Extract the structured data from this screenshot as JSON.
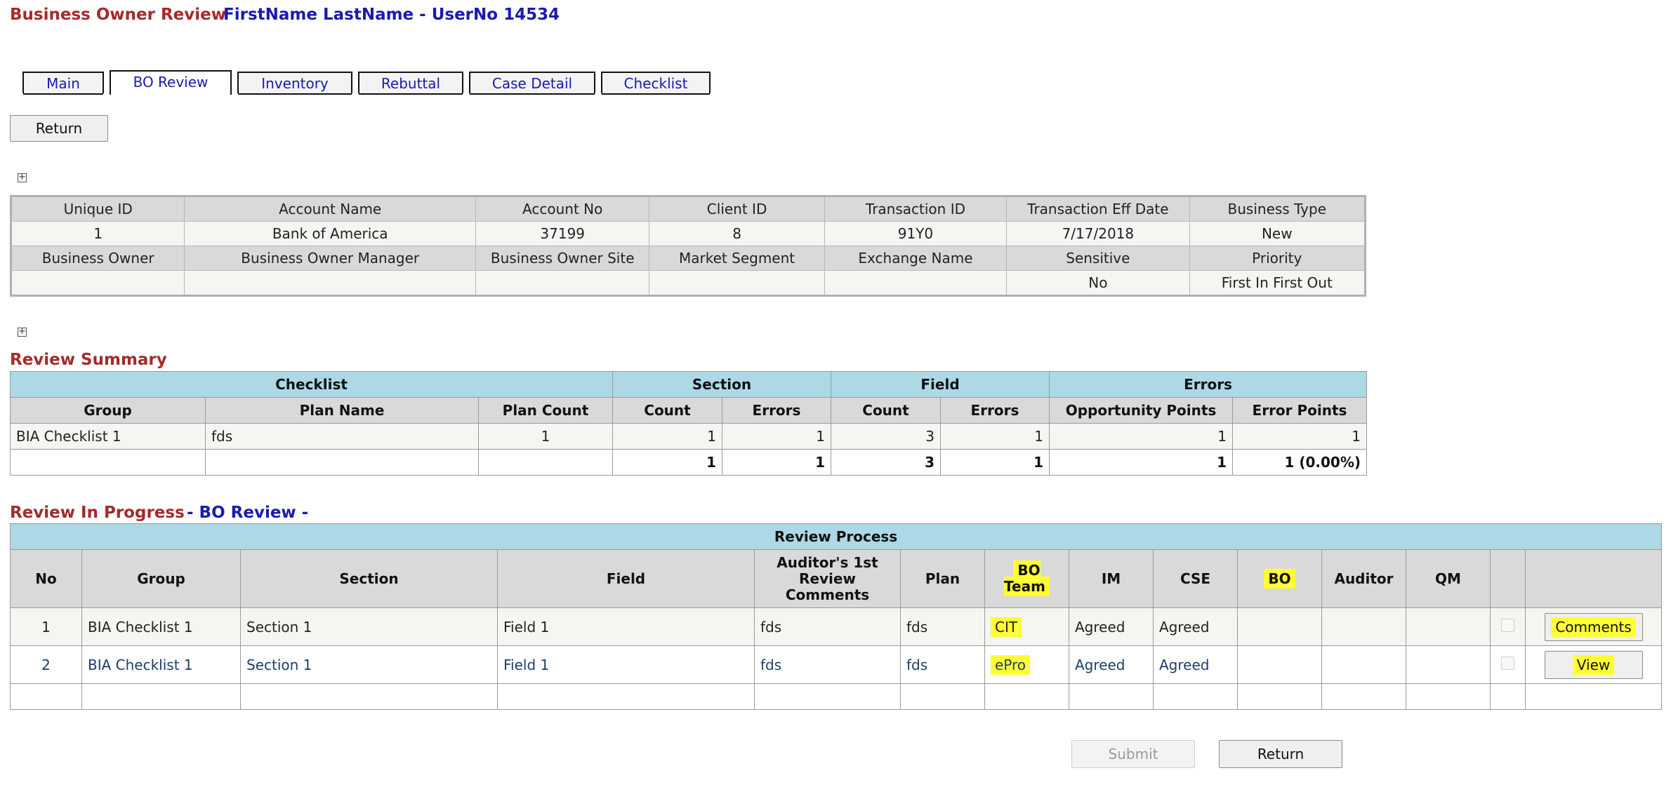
{
  "header": {
    "title": "Business Owner Review",
    "user": "FirstName LastName - UserNo 14534"
  },
  "tabs": [
    {
      "label": "Main",
      "active": false
    },
    {
      "label": "BO Review",
      "active": true
    },
    {
      "label": "Inventory",
      "active": false
    },
    {
      "label": "Rebuttal",
      "active": false
    },
    {
      "label": "Case Detail",
      "active": false
    },
    {
      "label": "Checklist",
      "active": false
    }
  ],
  "buttons": {
    "return_top": "Return",
    "submit": "Submit",
    "return_bottom": "Return"
  },
  "info": {
    "row1_labels": [
      "Unique ID",
      "Account Name",
      "Account No",
      "Client ID",
      "Transaction ID",
      "Transaction Eff Date",
      "Business Type"
    ],
    "row1_values": [
      "1",
      "Bank of America",
      "37199",
      "8",
      "91Y0",
      "7/17/2018",
      "New"
    ],
    "row2_labels": [
      "Business Owner",
      "Business Owner Manager",
      "Business Owner Site",
      "Market Segment",
      "Exchange Name",
      "Sensitive",
      "Priority"
    ],
    "row2_values": [
      "",
      "",
      "",
      "",
      "",
      "No",
      "First In First Out"
    ]
  },
  "summary": {
    "title": "Review Summary",
    "groups": [
      "Checklist",
      "Section",
      "Field",
      "Errors"
    ],
    "columns": [
      "Group",
      "Plan Name",
      "Plan Count",
      "Count",
      "Errors",
      "Count",
      "Errors",
      "Opportunity Points",
      "Error Points"
    ],
    "row": [
      "BIA Checklist 1",
      "fds",
      "1",
      "1",
      "1",
      "3",
      "1",
      "1",
      "1"
    ],
    "totals": [
      "",
      "",
      "",
      "1",
      "1",
      "3",
      "1",
      "1",
      "1 (0.00%)"
    ]
  },
  "review": {
    "title": "Review In Progress",
    "subtitle": "- BO Review -",
    "table_title": "Review Process",
    "columns": [
      "No",
      "Group",
      "Section",
      "Field",
      "Auditor's 1st Review Comments",
      "Plan",
      "BO Team",
      "IM",
      "CSE",
      "BO",
      "Auditor",
      "QM"
    ],
    "rows": [
      {
        "no": "1",
        "group": "BIA Checklist 1",
        "section": "Section 1",
        "field": "Field 1",
        "comments": "fds",
        "plan": "fds",
        "bo_team": "CIT",
        "im": "Agreed",
        "cse": "Agreed",
        "bo": "",
        "auditor": "",
        "qm": "",
        "action": "Comments"
      },
      {
        "no": "2",
        "group": "BIA Checklist 1",
        "section": "Section 1",
        "field": "Field 1",
        "comments": "fds",
        "plan": "fds",
        "bo_team": "ePro",
        "im": "Agreed",
        "cse": "Agreed",
        "bo": "",
        "auditor": "",
        "qm": "",
        "action": "View"
      }
    ]
  },
  "colors": {
    "section_title": "#a52a2a",
    "link_blue": "#1a1ab0",
    "header_blue": "#add8e6",
    "highlight": "#ffff33",
    "error_red": "#dd1111"
  }
}
